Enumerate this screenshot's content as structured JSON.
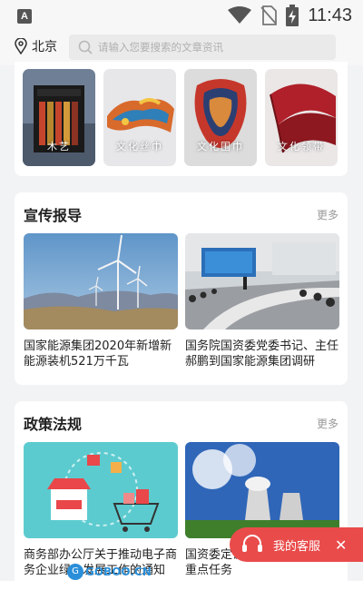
{
  "status_bar": {
    "time": "11:43",
    "app_icon_letter": "A"
  },
  "header": {
    "location": "北京",
    "search_placeholder": "请输入您要搜索的文章资讯"
  },
  "culture": {
    "items": [
      {
        "label": "木艺"
      },
      {
        "label": "文化丝巾"
      },
      {
        "label": "文化围巾"
      },
      {
        "label": "文化领带"
      }
    ]
  },
  "propaganda": {
    "title": "宣传报导",
    "more": "更多",
    "articles": [
      {
        "title": "国家能源集团2020年新增新能源装机521万千瓦"
      },
      {
        "title": "国务院国资委党委书记、主任郝鹏到国家能源集团调研"
      }
    ]
  },
  "policy": {
    "title": "政策法规",
    "more": "更多",
    "articles": [
      {
        "title": "商务部办公厅关于推动电子商务企业绿色发展工作的通知"
      },
      {
        "title": "国资委定调2021年国企十大重点任务"
      }
    ]
  },
  "service": {
    "label": "我的客服"
  },
  "watermark": {
    "badge": "G",
    "text": "GOBOO.CN"
  },
  "colors": {
    "accent": "#e94b4b",
    "background": "#f2f3f5"
  }
}
